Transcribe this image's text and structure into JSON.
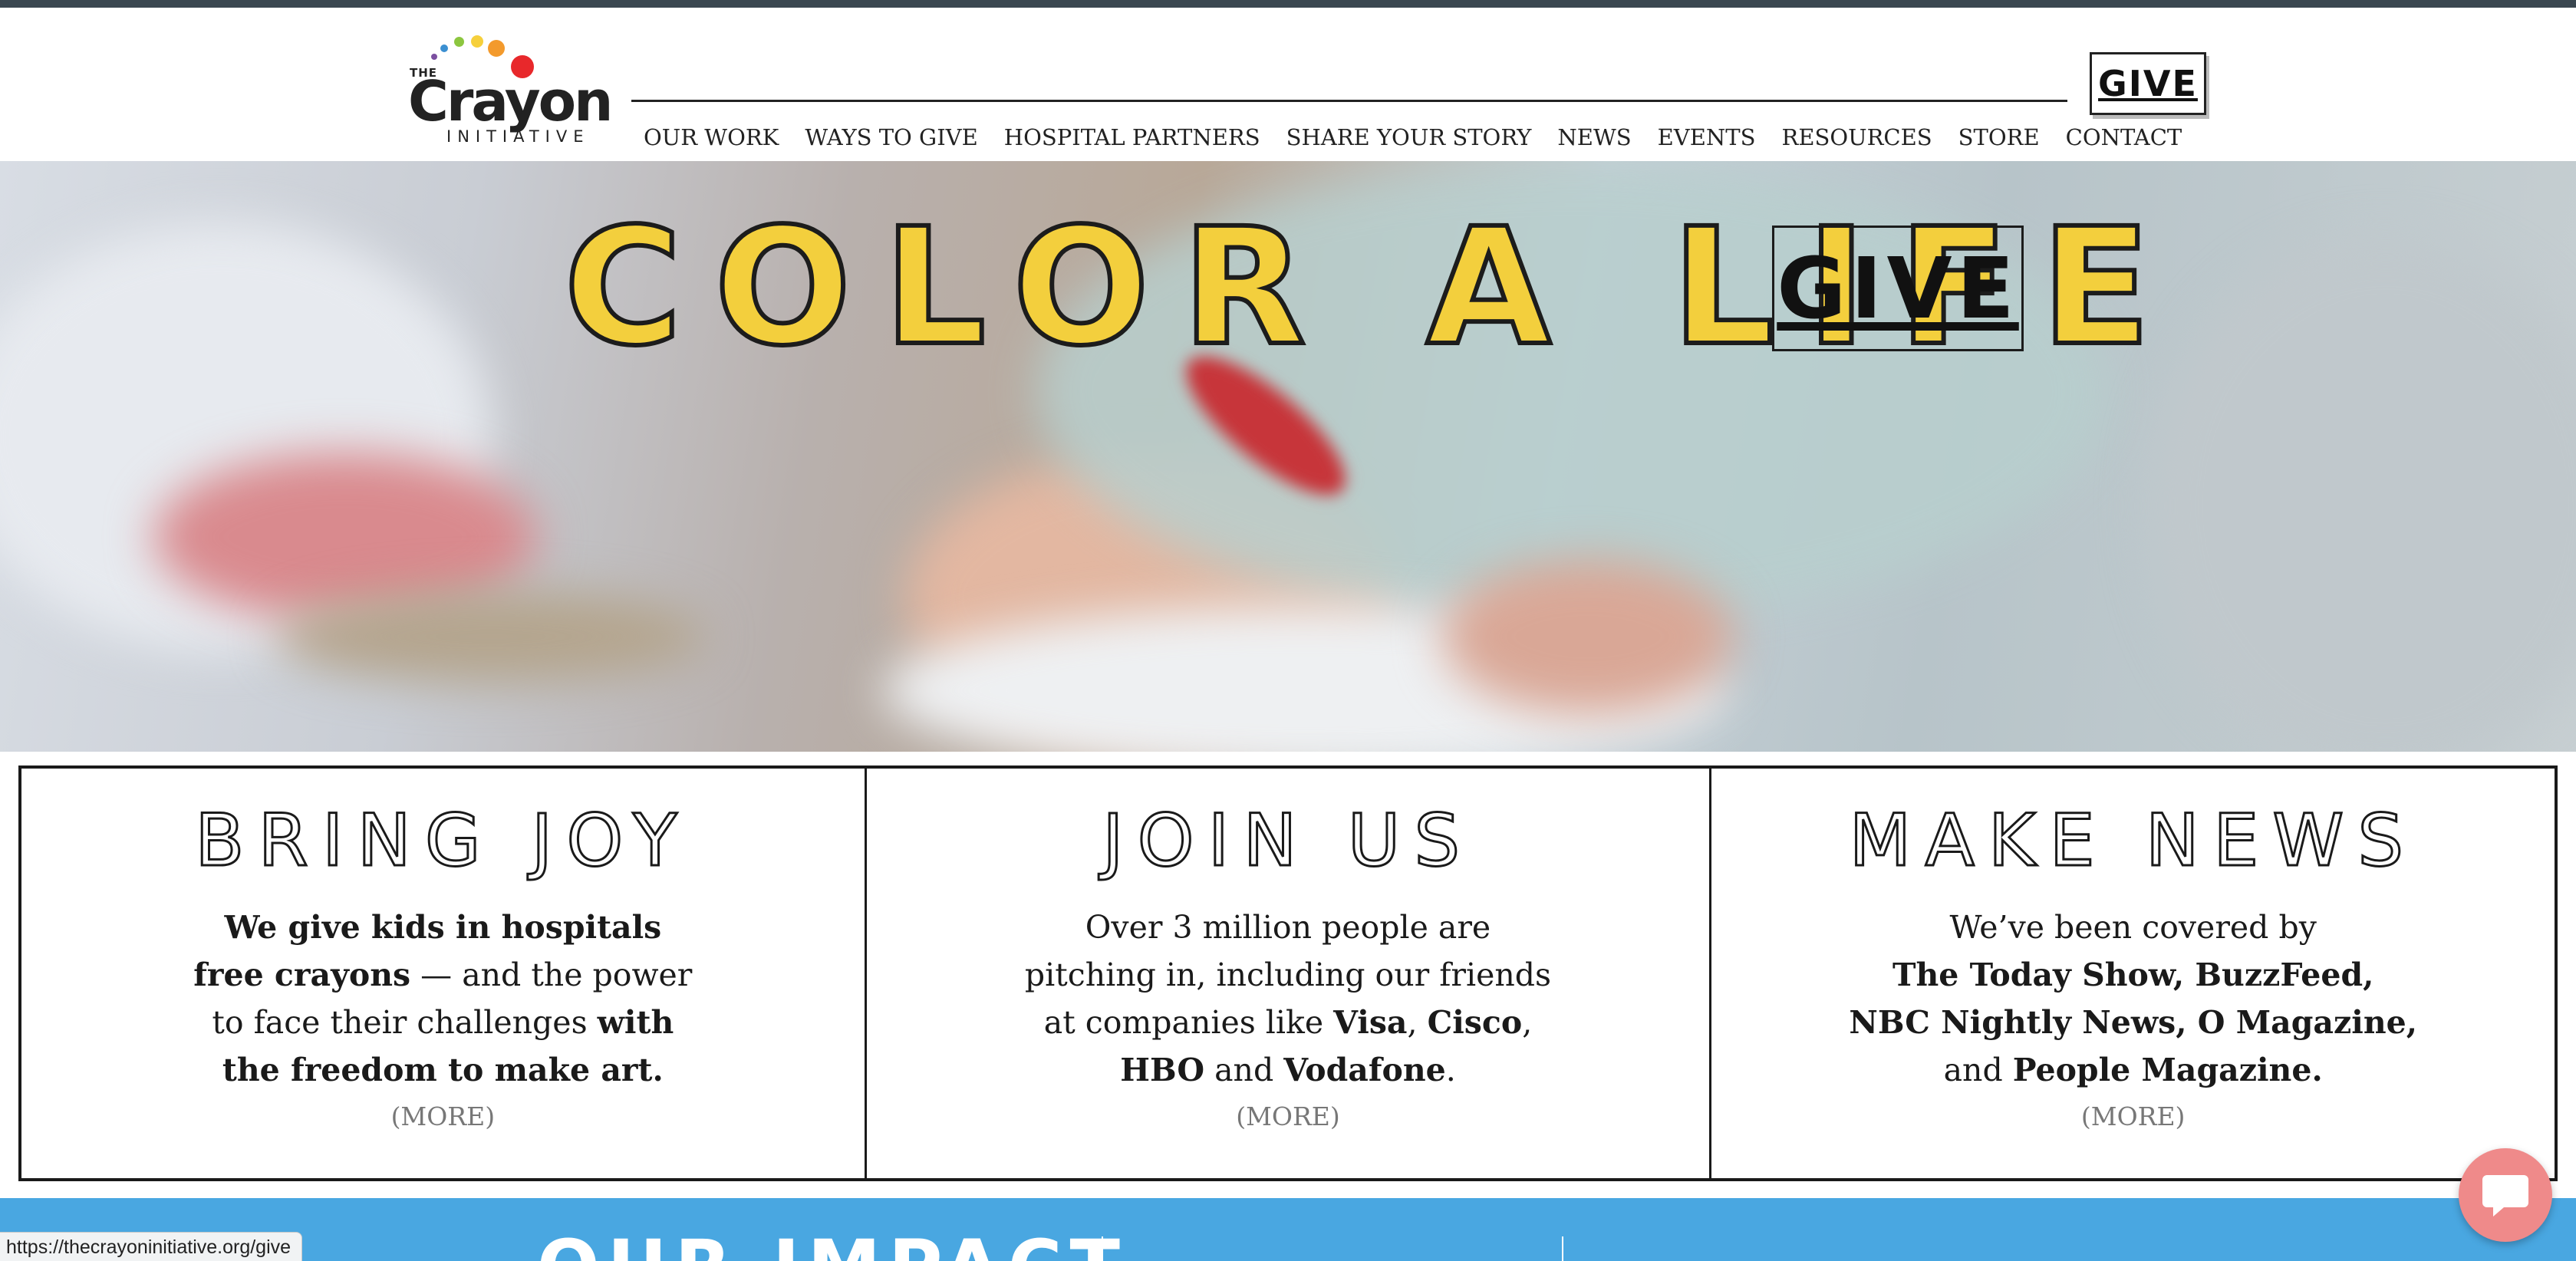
{
  "header": {
    "logo": {
      "the": "THE",
      "name": "Crayon",
      "sub": "INITIATIVE",
      "dot_colors": [
        "#7b4fa0",
        "#3b8fd1",
        "#8cc63f",
        "#f6d03c",
        "#f39a2c",
        "#e8282b"
      ]
    },
    "nav": [
      "OUR WORK",
      "WAYS TO GIVE",
      "HOSPITAL PARTNERS",
      "SHARE YOUR STORY",
      "NEWS",
      "EVENTS",
      "RESOURCES",
      "STORE",
      "CONTACT"
    ],
    "give_button": "GIVE"
  },
  "hero": {
    "title": "COLOR A LIFE",
    "give_button": "GIVE",
    "title_color": "#f3cf3d"
  },
  "boxes": [
    {
      "title": "BRING JOY",
      "lines": [
        [
          {
            "t": "We give kids in hospitals",
            "b": true
          }
        ],
        [
          {
            "t": "free crayons",
            "b": true
          },
          {
            "t": " — and the power",
            "b": false
          }
        ],
        [
          {
            "t": "to face their challenges ",
            "b": false
          },
          {
            "t": "with",
            "b": true
          }
        ],
        [
          {
            "t": "the freedom to make art.",
            "b": true
          }
        ]
      ],
      "more": "(MORE)"
    },
    {
      "title": "JOIN US",
      "lines": [
        [
          {
            "t": "Over 3 million people are",
            "b": false
          }
        ],
        [
          {
            "t": "pitching in, including our friends",
            "b": false
          }
        ],
        [
          {
            "t": "at companies like ",
            "b": false
          },
          {
            "t": "Visa",
            "b": true
          },
          {
            "t": ", ",
            "b": false
          },
          {
            "t": "Cisco",
            "b": true
          },
          {
            "t": ",",
            "b": false
          }
        ],
        [
          {
            "t": "HBO",
            "b": true
          },
          {
            "t": " and ",
            "b": false
          },
          {
            "t": "Vodafone",
            "b": true
          },
          {
            "t": ".",
            "b": false
          }
        ]
      ],
      "more": "(MORE)"
    },
    {
      "title": "MAKE NEWS",
      "lines": [
        [
          {
            "t": "We’ve been covered by",
            "b": false
          }
        ],
        [
          {
            "t": "The Today Show, BuzzFeed,",
            "b": true
          }
        ],
        [
          {
            "t": "NBC Nightly News, O Magazine,",
            "b": true
          }
        ],
        [
          {
            "t": "and ",
            "b": false
          },
          {
            "t": "People Magazine.",
            "b": true
          }
        ]
      ],
      "more": "(MORE)"
    }
  ],
  "impact": {
    "title": "OUR IMPACT",
    "band_color": "#49a7e1"
  },
  "status_bar": {
    "url": "https://thecrayoninitiative.org/give"
  },
  "chat": {
    "icon": "chat-bubble-icon",
    "color": "#ef8a8a"
  }
}
